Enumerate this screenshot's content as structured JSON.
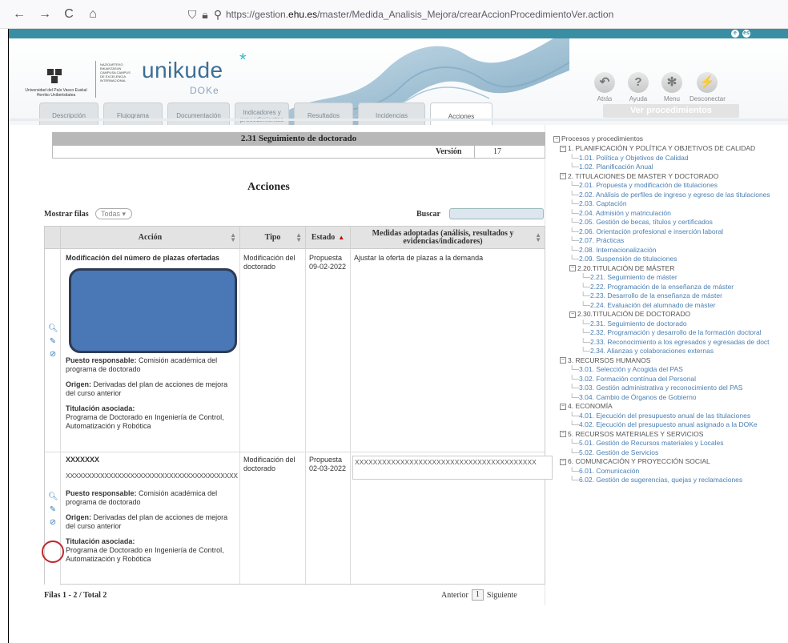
{
  "browser": {
    "back": "←",
    "forward": "→",
    "reload": "C",
    "home": "⌂",
    "url_prefix": "https://gestion.",
    "url_domain": "ehu.es",
    "url_path": "/master/Medida_Analisis_Mejora/crearAccionProcedimientoVer.action"
  },
  "lang": [
    "e",
    "es"
  ],
  "logo": {
    "org_text": "Universidad del País Vasco   Euskal Herriko Unibertsitatea",
    "campus_text": "NAZIOARTEKO BIKAINTASUN CAMPUSA CAMPUS DE EXCELENCIA INTERNACIONAL",
    "brand": "unikude",
    "brand_star": "*",
    "brand_sub": "DOKe"
  },
  "tools": [
    {
      "label": "Atrás",
      "glyph": "↶"
    },
    {
      "label": "Ayuda",
      "glyph": "?"
    },
    {
      "label": "Menu",
      "glyph": "✻"
    },
    {
      "label": "Desconectar",
      "glyph": "⚡"
    }
  ],
  "ver_procedimientos": "Ver procedimientos",
  "tabs": [
    {
      "label": "Descripción",
      "active": false
    },
    {
      "label": "Flujograma",
      "active": false
    },
    {
      "label": "Documentación",
      "active": false
    },
    {
      "label": "Indicadores y procedimientos",
      "active": false
    },
    {
      "label": "Resultados",
      "active": false
    },
    {
      "label": "Incidencias",
      "active": false
    },
    {
      "label": "Acciones",
      "active": true
    }
  ],
  "main": {
    "title": "2.31 Seguimiento de doctorado",
    "version_label": "Versión",
    "version_value": "17",
    "heading": "Acciones",
    "show_rows_label": "Mostrar filas",
    "show_rows_value": "Todas",
    "search_label": "Buscar",
    "columns": [
      {
        "label": "Acción"
      },
      {
        "label": "Tipo"
      },
      {
        "label": "Estado"
      },
      {
        "label": "Medidas adoptadas (análisis, resultados y evidencias/indicadores)"
      }
    ],
    "rows": [
      {
        "accion_title": "Modificación del número de plazas ofertadas",
        "puesto_label": "Puesto responsable:",
        "puesto_value": "Comisión académica del programa de doctorado",
        "origen_label": "Origen:",
        "origen_value": "Derivadas del plan de acciones de mejora del curso anterior",
        "titulacion_label": "Titulación asociada:",
        "titulacion_value": "Programa de Doctorado en Ingeniería de Control, Automatización y Robótica",
        "tipo": "Modificación del doctorado",
        "estado": "Propuesta",
        "fecha": "09-02-2022",
        "medidas": "Ajustar la oferta de plazas a la demanda"
      },
      {
        "accion_title": "XXXXXXX",
        "accion_desc": "XXXXXXXXXXXXXXXXXXXXXXXXXXXXXXXXXXXXXXXX",
        "puesto_label": "Puesto responsable:",
        "puesto_value": "Comisión académica del programa de doctorado",
        "origen_label": "Origen:",
        "origen_value": "Derivadas del plan de acciones de mejora del curso anterior",
        "titulacion_label": "Titulación asociada:",
        "titulacion_value": "Programa de Doctorado en Ingeniería de Control, Automatización y Robótica",
        "tipo": "Modificación del doctorado",
        "estado": "Propuesta",
        "fecha": "02-03-2022",
        "medidas": "XXXXXXXXXXXXXXXXXXXXXXXXXXXXXXXXXXXXXXXX"
      }
    ],
    "footer_info": "Filas 1 - 2 / Total 2",
    "pager_prev": "Anterior",
    "pager_page": "1",
    "pager_next": "Siguiente"
  },
  "tree": {
    "root": "Procesos y procedimientos",
    "nodes": [
      {
        "text": "1. PLANIFICACIÓN Y POLÍTICA Y OBJETIVOS DE CALIDAD",
        "level": 1,
        "section": true
      },
      {
        "text": "1.01. Política y Objetivos de Calidad",
        "level": 2
      },
      {
        "text": "1.02. Planificación Anual",
        "level": 2
      },
      {
        "text": "2. TITULACIONES DE MASTER Y DOCTORADO",
        "level": 1,
        "section": true
      },
      {
        "text": "2.01. Propuesta y modificación de titulaciones",
        "level": 2
      },
      {
        "text": "2.02. Análisis de perfiles de ingreso y egreso de las titulaciones",
        "level": 2
      },
      {
        "text": "2.03. Captación",
        "level": 2
      },
      {
        "text": "2.04. Admisión y matriculación",
        "level": 2
      },
      {
        "text": "2.05. Gestión de becas, títulos y certificados",
        "level": 2
      },
      {
        "text": "2.06. Orientación profesional e inserción laboral",
        "level": 2
      },
      {
        "text": "2.07. Prácticas",
        "level": 2
      },
      {
        "text": "2.08. Internacionalización",
        "level": 2
      },
      {
        "text": "2.09. Suspensión de titulaciones",
        "level": 2
      },
      {
        "text": "2.20.TITULACIÓN DE MÁSTER",
        "level": 2,
        "section": true
      },
      {
        "text": "2.21. Seguimiento de máster",
        "level": 3
      },
      {
        "text": "2.22. Programación de la enseñanza de máster",
        "level": 3
      },
      {
        "text": "2.23. Desarrollo de la enseñanza de máster",
        "level": 3
      },
      {
        "text": "2.24. Evaluación del alumnado de máster",
        "level": 3
      },
      {
        "text": "2.30.TITULACIÓN DE DOCTORADO",
        "level": 2,
        "section": true
      },
      {
        "text": "2.31. Seguimiento de doctorado",
        "level": 3
      },
      {
        "text": "2.32. Programación y desarrollo de la formación doctoral",
        "level": 3
      },
      {
        "text": "2.33. Reconocimiento a los egresados y egresadas de doct",
        "level": 3
      },
      {
        "text": "2.34. Alianzas y colaboraciones externas",
        "level": 3
      },
      {
        "text": "3. RECURSOS HUMANOS",
        "level": 1,
        "section": true
      },
      {
        "text": "3.01. Selección y Acogida del PAS",
        "level": 2
      },
      {
        "text": "3.02. Formación contínua del Personal",
        "level": 2
      },
      {
        "text": "3.03. Gestión administrativa y reconocimiento del PAS",
        "level": 2
      },
      {
        "text": "3.04. Cambio de Órganos de Gobierno",
        "level": 2
      },
      {
        "text": "4. ECONOMÍA",
        "level": 1,
        "section": true
      },
      {
        "text": "4.01. Ejecución del presupuesto anual de las titulaciones",
        "level": 2
      },
      {
        "text": "4.02. Ejecución del presupuesto anual asignado a la DOKe",
        "level": 2
      },
      {
        "text": "5. RECURSOS MATERIALES Y SERVICIOS",
        "level": 1,
        "section": true
      },
      {
        "text": "5.01. Gestión de Recursos materiales y Locales",
        "level": 2
      },
      {
        "text": "5.02. Gestión de Servicios",
        "level": 2
      },
      {
        "text": "6. COMUNICACIÓN Y PROYECCIÓN SOCIAL",
        "level": 1,
        "section": true
      },
      {
        "text": "6.01. Comunicación",
        "level": 2
      },
      {
        "text": "6.02. Gestión de sugerencias, quejas y reclamaciones",
        "level": 2
      }
    ]
  }
}
